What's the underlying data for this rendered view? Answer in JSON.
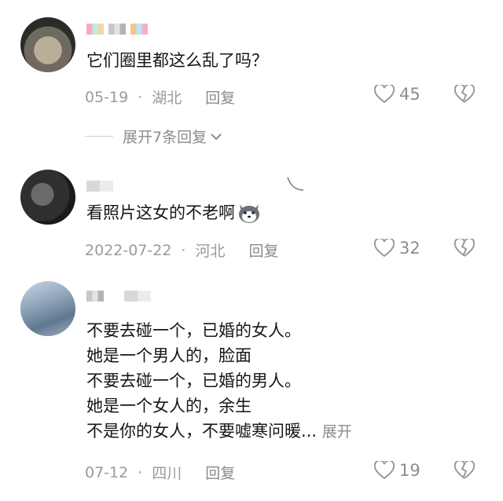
{
  "comments": [
    {
      "text": "它们圈里都这么乱了吗？",
      "date": "05-19",
      "location": "湖北",
      "reply_label": "回复",
      "likes": "45",
      "expand_replies": "展开7条回复"
    },
    {
      "text": "看照片这女的不老啊",
      "date": "2022-07-22",
      "location": "河北",
      "reply_label": "回复",
      "likes": "32"
    },
    {
      "lines": [
        "不要去碰一个，已婚的女人。",
        "她是一个男人的，脸面",
        "不要去碰一个，已婚的男人。",
        "她是一个女人的，余生",
        "不是你的女人，不要嘘寒问暖..."
      ],
      "expand_label": "展开",
      "date": "07-12",
      "location": "四川",
      "reply_label": "回复",
      "likes": "19"
    }
  ],
  "separator": "·",
  "icons": {
    "like": "heart-outline-icon",
    "dislike": "broken-heart-icon",
    "expand": "chevron-down-icon",
    "emoji": "husky-emoji-icon"
  }
}
